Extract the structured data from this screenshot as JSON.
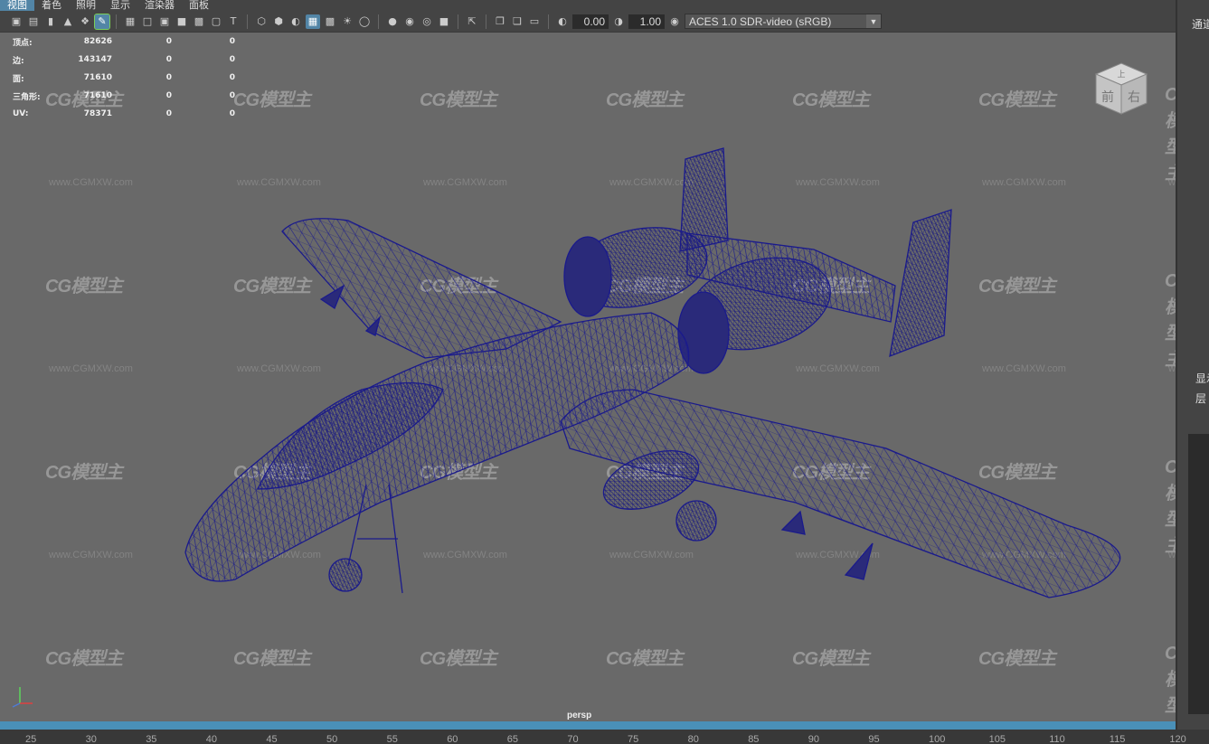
{
  "menu": [
    "视图",
    "着色",
    "照明",
    "显示",
    "渲染器",
    "面板"
  ],
  "toolbar": {
    "icons": [
      "camera-icon",
      "camera-attr-icon",
      "bookmark-icon",
      "image-plane-icon",
      "grid-icon",
      "film-gate-icon",
      "resolution-gate-icon",
      "gate-mask-icon",
      "field-chart-icon",
      "safe-action-icon",
      "safe-title-icon",
      "wireframe-icon",
      "smooth-shade-icon",
      "flat-shade-icon",
      "wireframe-on-shaded-icon",
      "xray-icon",
      "lights-icon",
      "shadows-icon",
      "ambient-occlusion-icon",
      "motion-blur-icon",
      "antialias-icon",
      "depth-of-field-icon",
      "isolate-select-icon",
      "xray-joints-icon",
      "xray-active-icon",
      "backface-icon",
      "exposure-icon",
      "gamma-icon",
      "color-mgmt-icon"
    ],
    "exposure": "0.00",
    "gamma": "1.00",
    "color_space": "ACES 1.0 SDR-video (sRGB)"
  },
  "hud": [
    {
      "label": "顶点:",
      "v1": "82626",
      "v2": "0",
      "v3": "0"
    },
    {
      "label": "边:",
      "v1": "143147",
      "v2": "0",
      "v3": "0"
    },
    {
      "label": "面:",
      "v1": "71610",
      "v2": "0",
      "v3": "0"
    },
    {
      "label": "三角形:",
      "v1": "71610",
      "v2": "0",
      "v3": "0"
    },
    {
      "label": "UV:",
      "v1": "78371",
      "v2": "0",
      "v3": "0"
    }
  ],
  "viewcube": {
    "top": "上",
    "front": "前",
    "right": "右"
  },
  "camera": "persp",
  "watermark": {
    "brand": "CG模型主",
    "url": "www.CGMXW.com"
  },
  "timeline_ticks": [
    "25",
    "30",
    "35",
    "40",
    "45",
    "50",
    "55",
    "60",
    "65",
    "70",
    "75",
    "80",
    "85",
    "90",
    "95",
    "100",
    "105",
    "110",
    "115",
    "120"
  ],
  "right_panel": {
    "title": "通道",
    "display": "显示",
    "layers": "层"
  },
  "colors": {
    "viewport_bg": "#696969",
    "wireframe": "#1a1a8c",
    "accent": "#5285a6",
    "timeline": "#4a90b8"
  }
}
